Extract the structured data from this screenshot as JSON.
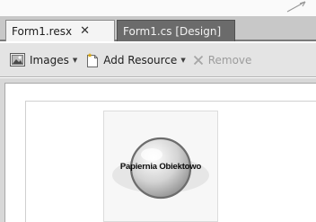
{
  "tabs": [
    {
      "label": "Form1.resx",
      "active": true,
      "close_glyph": "✕"
    },
    {
      "label": "Form1.cs [Design]",
      "active": false
    }
  ],
  "toolbar": {
    "images_label": "Images",
    "add_resource_label": "Add Resource",
    "remove_label": "Remove",
    "images_icon": "images-icon",
    "add_resource_icon": "add-resource-icon",
    "remove_icon": "remove-icon"
  },
  "resource": {
    "logo_text": "Papiernia Obiektowo"
  },
  "colors": {
    "tabbar_bg": "#c8c8c8",
    "active_tab_bg": "#f4f4f4",
    "inactive_tab_bg": "#6b6b6b",
    "toolbar_bg": "#e4e4e4",
    "canvas_bg": "#ffffff"
  }
}
